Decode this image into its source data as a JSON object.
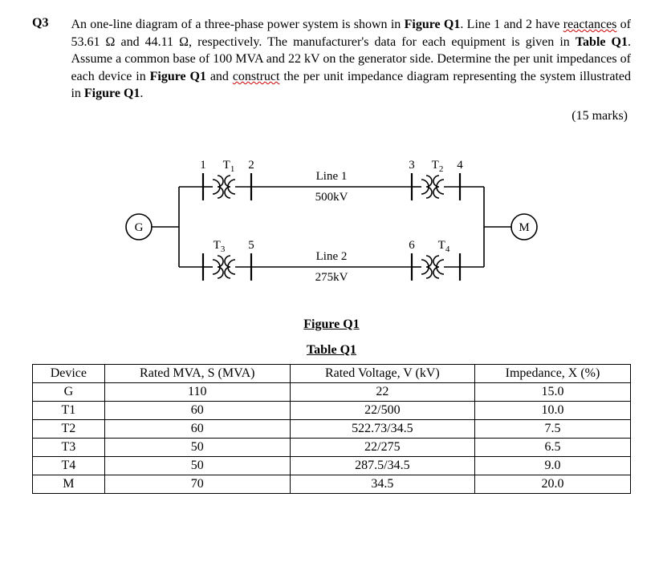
{
  "question": {
    "number": "Q3",
    "text_parts": {
      "p1": "An one-line diagram of a three-phase power system is shown in ",
      "figref1": "Figure Q1",
      "p2": ". Line 1 and 2 have ",
      "reactances": "reactances",
      "p3": " of 53.61 Ω and 44.11 Ω, respectively. The manufacturer's data for each equipment is given in ",
      "tabref": "Table Q1",
      "p4": ". Assume a common base of 100 MVA and 22 kV on the generator side.  Determine the per unit impedances of each device in ",
      "figref2": "Figure Q1",
      "p5": " and ",
      "construct": "construct",
      "p6": " the per unit impedance diagram representing the system illustrated in ",
      "figref3": "Figure Q1",
      "p7": "."
    },
    "marks": "(15 marks)"
  },
  "figure": {
    "G": "G",
    "M": "M",
    "T1": "T",
    "T1s": "1",
    "T2": "T",
    "T2s": "2",
    "T3": "T",
    "T3s": "3",
    "T4": "T",
    "T4s": "4",
    "n1": "1",
    "n2": "2",
    "n3": "3",
    "n4": "4",
    "n5": "5",
    "n6": "6",
    "line1": "Line 1",
    "line1v": "500kV",
    "line2": "Line 2",
    "line2v": "275kV",
    "caption": "Figure Q1"
  },
  "table": {
    "caption": "Table Q1",
    "headers": {
      "device": "Device",
      "mva": "Rated MVA, S (MVA)",
      "kv": "Rated Voltage, V (kV)",
      "x": "Impedance, X (%)"
    },
    "rows": [
      {
        "device": "G",
        "mva": "110",
        "kv": "22",
        "x": "15.0"
      },
      {
        "device": "T1",
        "mva": "60",
        "kv": "22/500",
        "x": "10.0"
      },
      {
        "device": "T2",
        "mva": "60",
        "kv": "522.73/34.5",
        "x": "7.5"
      },
      {
        "device": "T3",
        "mva": "50",
        "kv": "22/275",
        "x": "6.5"
      },
      {
        "device": "T4",
        "mva": "50",
        "kv": "287.5/34.5",
        "x": "9.0"
      },
      {
        "device": "M",
        "mva": "70",
        "kv": "34.5",
        "x": "20.0"
      }
    ]
  }
}
